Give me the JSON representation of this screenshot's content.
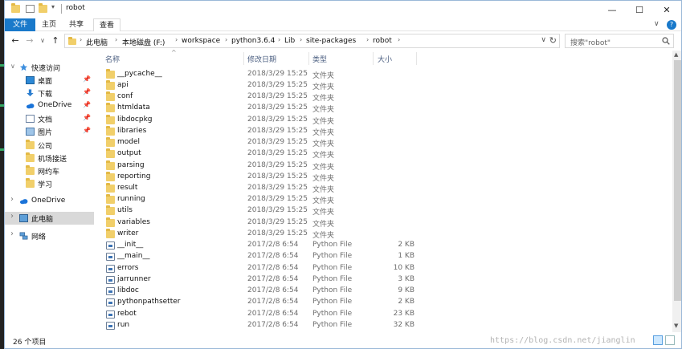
{
  "window": {
    "title": "robot"
  },
  "window_controls": {
    "minimize": "—",
    "maximize": "☐",
    "close": "✕"
  },
  "ribbon": {
    "tabs": [
      {
        "label": "文件"
      },
      {
        "label": "主页"
      },
      {
        "label": "共享"
      },
      {
        "label": "查看"
      }
    ],
    "collapse": "∨",
    "help": "?"
  },
  "nav": {
    "back": "←",
    "forward": "→",
    "recent": "∨",
    "up": "↑"
  },
  "address": {
    "crumbs": [
      "此电脑",
      "本地磁盘 (F:)",
      "workspace",
      "python3.6.4",
      "Lib",
      "site-packages",
      "robot"
    ],
    "separator": "›",
    "dropdown": "∨",
    "refresh": "↻"
  },
  "search": {
    "placeholder": "搜索\"robot\""
  },
  "sidebar": {
    "quick_access": "快速访问",
    "pinned": [
      {
        "label": "桌面",
        "icon": "desktop-icon"
      },
      {
        "label": "下载",
        "icon": "download-icon"
      },
      {
        "label": "OneDrive",
        "icon": "cloud-icon"
      },
      {
        "label": "文档",
        "icon": "document-icon"
      },
      {
        "label": "图片",
        "icon": "picture-icon"
      }
    ],
    "folders": [
      {
        "label": "公司"
      },
      {
        "label": "机场接送"
      },
      {
        "label": "网约车"
      },
      {
        "label": "学习"
      }
    ],
    "onedrive": "OneDrive",
    "this_pc": "此电脑",
    "network": "网络",
    "pin_glyph": "📌",
    "chevron_right": "›",
    "chevron_down": "∨"
  },
  "columns": {
    "name": "名称",
    "date": "修改日期",
    "type": "类型",
    "size": "大小",
    "sort_glyph": "^"
  },
  "files": [
    {
      "name": "__pycache__",
      "date": "2018/3/29 15:25",
      "type": "文件夹",
      "size": "",
      "kind": "folder"
    },
    {
      "name": "api",
      "date": "2018/3/29 15:25",
      "type": "文件夹",
      "size": "",
      "kind": "folder"
    },
    {
      "name": "conf",
      "date": "2018/3/29 15:25",
      "type": "文件夹",
      "size": "",
      "kind": "folder"
    },
    {
      "name": "htmldata",
      "date": "2018/3/29 15:25",
      "type": "文件夹",
      "size": "",
      "kind": "folder"
    },
    {
      "name": "libdocpkg",
      "date": "2018/3/29 15:25",
      "type": "文件夹",
      "size": "",
      "kind": "folder"
    },
    {
      "name": "libraries",
      "date": "2018/3/29 15:25",
      "type": "文件夹",
      "size": "",
      "kind": "folder"
    },
    {
      "name": "model",
      "date": "2018/3/29 15:25",
      "type": "文件夹",
      "size": "",
      "kind": "folder"
    },
    {
      "name": "output",
      "date": "2018/3/29 15:25",
      "type": "文件夹",
      "size": "",
      "kind": "folder"
    },
    {
      "name": "parsing",
      "date": "2018/3/29 15:25",
      "type": "文件夹",
      "size": "",
      "kind": "folder"
    },
    {
      "name": "reporting",
      "date": "2018/3/29 15:25",
      "type": "文件夹",
      "size": "",
      "kind": "folder"
    },
    {
      "name": "result",
      "date": "2018/3/29 15:25",
      "type": "文件夹",
      "size": "",
      "kind": "folder"
    },
    {
      "name": "running",
      "date": "2018/3/29 15:25",
      "type": "文件夹",
      "size": "",
      "kind": "folder"
    },
    {
      "name": "utils",
      "date": "2018/3/29 15:25",
      "type": "文件夹",
      "size": "",
      "kind": "folder"
    },
    {
      "name": "variables",
      "date": "2018/3/29 15:25",
      "type": "文件夹",
      "size": "",
      "kind": "folder"
    },
    {
      "name": "writer",
      "date": "2018/3/29 15:25",
      "type": "文件夹",
      "size": "",
      "kind": "folder"
    },
    {
      "name": "__init__",
      "date": "2017/2/8 6:54",
      "type": "Python File",
      "size": "2 KB",
      "kind": "file"
    },
    {
      "name": "__main__",
      "date": "2017/2/8 6:54",
      "type": "Python File",
      "size": "1 KB",
      "kind": "file"
    },
    {
      "name": "errors",
      "date": "2017/2/8 6:54",
      "type": "Python File",
      "size": "10 KB",
      "kind": "file"
    },
    {
      "name": "jarrunner",
      "date": "2017/2/8 6:54",
      "type": "Python File",
      "size": "3 KB",
      "kind": "file"
    },
    {
      "name": "libdoc",
      "date": "2017/2/8 6:54",
      "type": "Python File",
      "size": "9 KB",
      "kind": "file"
    },
    {
      "name": "pythonpathsetter",
      "date": "2017/2/8 6:54",
      "type": "Python File",
      "size": "2 KB",
      "kind": "file"
    },
    {
      "name": "rebot",
      "date": "2017/2/8 6:54",
      "type": "Python File",
      "size": "23 KB",
      "kind": "file"
    },
    {
      "name": "run",
      "date": "2017/2/8 6:54",
      "type": "Python File",
      "size": "32 KB",
      "kind": "file"
    }
  ],
  "scroll": {
    "up": "▲",
    "down": "▼"
  },
  "status": {
    "count": "26 个项目",
    "watermark": "https://blog.csdn.net/jianglin"
  },
  "colors": {
    "accent": "#1979ca",
    "folder": "#f1cf6a",
    "selected_nav": "#d9d9d9",
    "header_text": "#4d6082"
  }
}
